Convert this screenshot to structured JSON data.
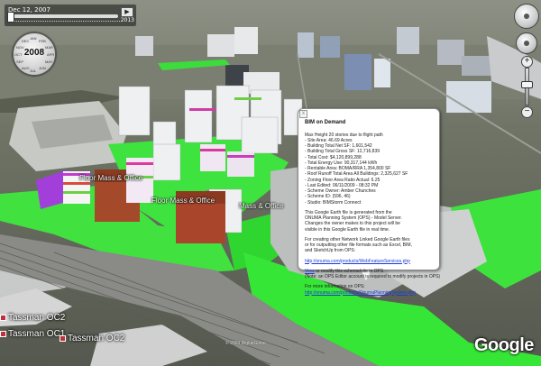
{
  "time_slider": {
    "date": "Dec 12, 2007",
    "end_year": "2013",
    "button_icon": "play-icon"
  },
  "year_dial": {
    "year": "2008",
    "months": [
      "JAN",
      "FEB",
      "MAR",
      "APR",
      "MAY",
      "JUN",
      "JUL",
      "AUG",
      "SEP",
      "OCT",
      "NOV",
      "DEC"
    ]
  },
  "navigation": {
    "look_icon": "look-joystick-icon",
    "move_icon": "move-joystick-icon",
    "zoom_in": "+",
    "zoom_out": "−"
  },
  "popup": {
    "title": "BIM on Demand",
    "lines": [
      "Max Height 20 stories due to flight path",
      "- Site Area: 46.69 Acres",
      "- Building Total Net SF: 1,601,542",
      "- Building Total Gross SF: 12,716,839",
      "- Total Cost: $4,120,899,288",
      "- Total Energy Use: 90,317,144 kWh",
      "- Rentable Area: BOMA/RRA 1,354,800 SF",
      "- Roof Runoff Total Area All Buildings: 2,325,627 SF",
      "- Zoning Floor Area Ratio Actual: 6.25",
      "- Last Edited: 06/11/2009 - 08:32 PM",
      "- Scheme Owner: Amber Chunches",
      "- Scheme ID: (596, 46)",
      "- Studio: BIMStorm Connect"
    ],
    "para1": [
      "This Google Earth file is generated from the",
      "ONUMA Planning System (OPS) - Model Server.",
      "Changes the owner makes to this project will be",
      "visible in this Google Earth file in real time."
    ],
    "para2": [
      "For creating other Network Linked Google Earth files",
      "or for outputting other file formats such as Excel, BIM,",
      "and SketchUp from OPS:"
    ],
    "link1": "http://onuma.com/products/WebFeatureServices.php",
    "link2_text": "View",
    "link2_rest": "or modify this scheme/site in OPS",
    "note": "(Note: an OPS Editor account is required to modify projects in OPS)",
    "para3": "For more information on OPS:",
    "link3": "http://onuma.com/products/OnumaPlanningSystem.php",
    "close": "x"
  },
  "map_labels": {
    "building_a": "Floor Mass & Office",
    "building_b": "Floor Mass & Office",
    "building_c": "Mass & Office",
    "station1": "Tassman OC2",
    "station2": "Tassman OC1",
    "station3": "Tassman OC2",
    "copyright": "© 2009 DigitalGlobe"
  },
  "logo": "Google"
}
